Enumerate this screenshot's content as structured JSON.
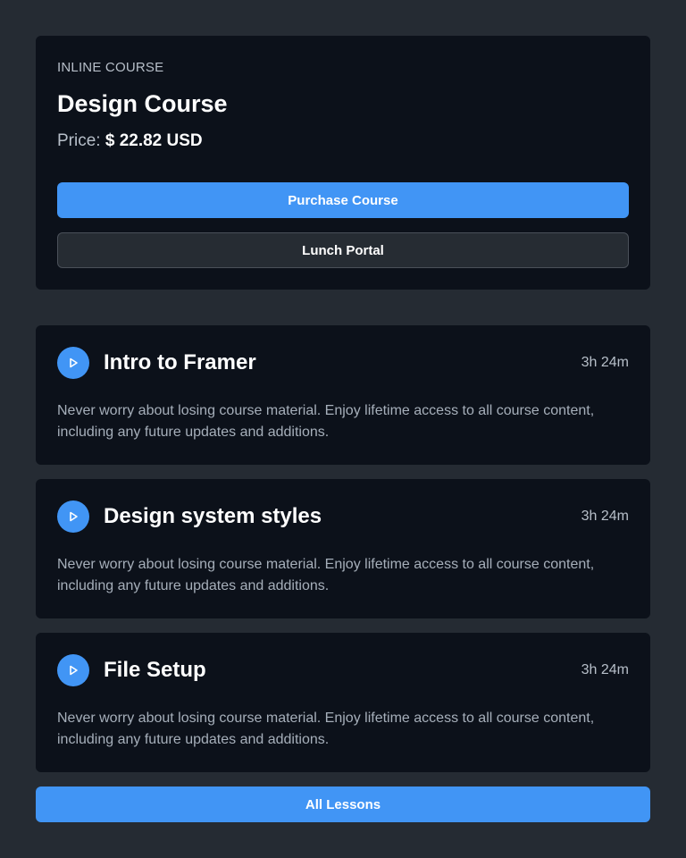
{
  "course": {
    "eyebrow": "INLINE COURSE",
    "title": "Design Course",
    "price_label": "Price:",
    "price_value": "$ 22.82 USD",
    "purchase_label": "Purchase Course",
    "portal_label": "Lunch Portal"
  },
  "lessons": [
    {
      "title": "Intro to Framer",
      "duration": "3h 24m",
      "description": "Never worry about losing course material. Enjoy lifetime access to all course content, including any future updates and additions."
    },
    {
      "title": "Design system styles",
      "duration": "3h 24m",
      "description": "Never worry about losing course material. Enjoy lifetime access to all course content, including any future updates and additions."
    },
    {
      "title": "File Setup",
      "duration": "3h 24m",
      "description": "Never worry about losing course material. Enjoy lifetime access to all course content, including any future updates and additions."
    }
  ],
  "all_lessons_label": "All Lessons",
  "icons": {
    "lesson": "play-icon"
  },
  "colors": {
    "background": "#252b33",
    "card": "#0c111a",
    "accent": "#4195f5"
  }
}
